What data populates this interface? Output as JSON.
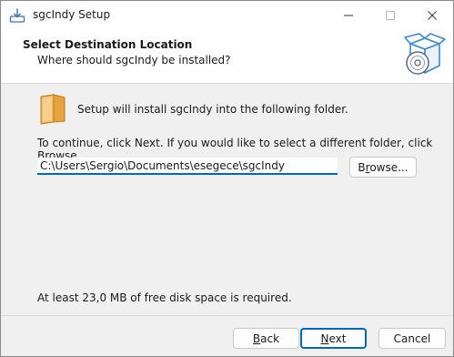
{
  "window": {
    "title": "sgcIndy Setup",
    "icon": "setup-installer-icon",
    "controls": {
      "minimize_icon": "minimize-icon",
      "maximize_icon": "maximize-icon",
      "close_icon": "close-icon"
    }
  },
  "header": {
    "title": "Select Destination Location",
    "subtitle": "Where should sgcIndy be installed?",
    "icon": "box-with-disc-icon"
  },
  "body": {
    "intro": "Setup will install sgcIndy into the following folder.",
    "instruction": "To continue, click Next. If you would like to select a different folder, click Browse.",
    "path_value": "C:\\Users\\Sergio\\Documents\\esegece\\sgcIndy",
    "browse": {
      "access_key": "r",
      "before": "B",
      "after": "owse..."
    },
    "disk_space": "At least 23,0 MB of free disk space is required."
  },
  "footer": {
    "back": {
      "access_key": "B",
      "rest": "ack"
    },
    "next": {
      "access_key": "N",
      "rest": "ext"
    },
    "cancel": "Cancel"
  },
  "colors": {
    "accent": "#0067c0",
    "folder": "#e8a33c"
  }
}
